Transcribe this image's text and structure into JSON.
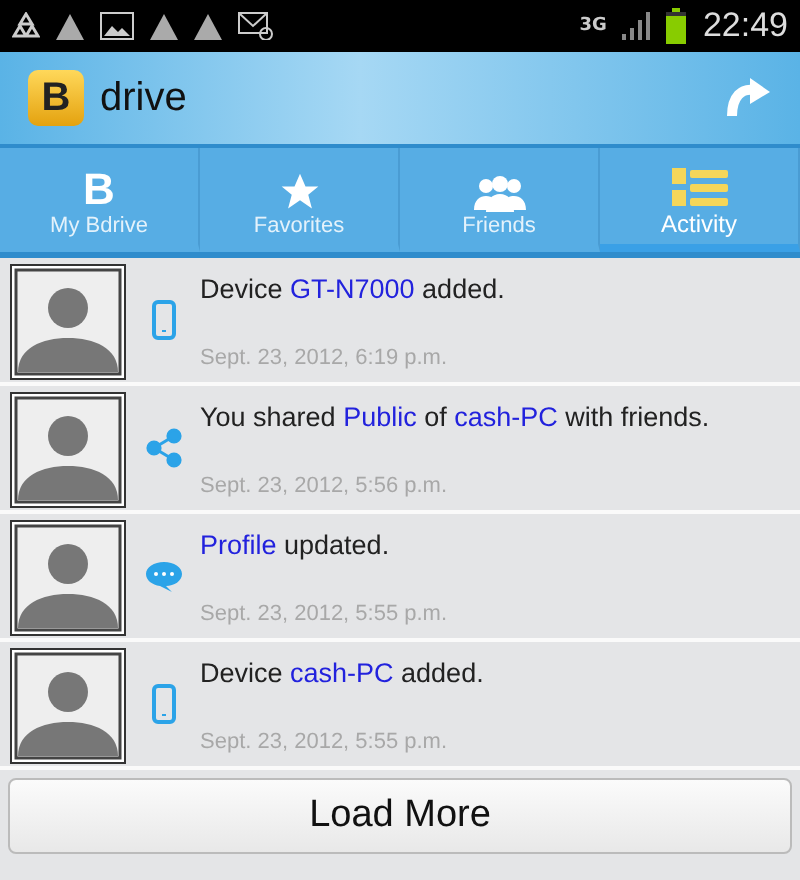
{
  "status_bar": {
    "network": "3G",
    "time": "22:49"
  },
  "action_bar": {
    "logo_letter": "B",
    "title": "drive"
  },
  "tabs": [
    {
      "label": "My Bdrive",
      "kind": "letter",
      "glyph": "B",
      "selected": false
    },
    {
      "label": "Favorites",
      "kind": "star",
      "selected": false
    },
    {
      "label": "Friends",
      "kind": "people",
      "selected": false
    },
    {
      "label": "Activity",
      "kind": "list",
      "selected": true
    }
  ],
  "activities": [
    {
      "kind": "device",
      "parts": [
        {
          "text": "Device ",
          "link": false
        },
        {
          "text": "GT-N7000",
          "link": true
        },
        {
          "text": " added.",
          "link": false
        }
      ],
      "date": "Sept. 23, 2012, 6:19 p.m."
    },
    {
      "kind": "share",
      "parts": [
        {
          "text": "You shared ",
          "link": false
        },
        {
          "text": "Public",
          "link": true
        },
        {
          "text": " of ",
          "link": false
        },
        {
          "text": "cash-PC",
          "link": true
        },
        {
          "text": " with friends.",
          "link": false
        }
      ],
      "date": "Sept. 23, 2012, 5:56 p.m."
    },
    {
      "kind": "profile",
      "parts": [
        {
          "text": "Profile",
          "link": true
        },
        {
          "text": " updated.",
          "link": false
        }
      ],
      "date": "Sept. 23, 2012, 5:55 p.m."
    },
    {
      "kind": "device",
      "parts": [
        {
          "text": "Device ",
          "link": false
        },
        {
          "text": "cash-PC",
          "link": true
        },
        {
          "text": " added.",
          "link": false
        }
      ],
      "date": "Sept. 23, 2012, 5:55 p.m."
    }
  ],
  "load_more": "Load More"
}
